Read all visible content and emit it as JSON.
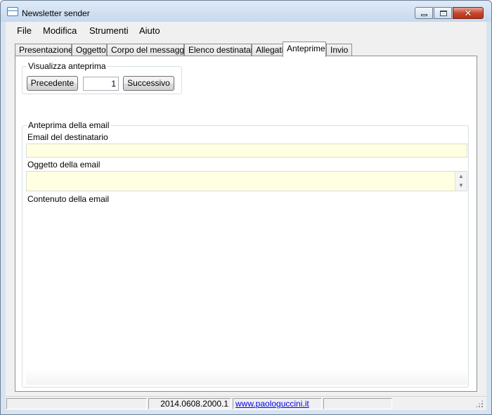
{
  "window": {
    "title": "Newsletter sender",
    "icon": "app-window-icon"
  },
  "menu": {
    "items": [
      {
        "label": "File"
      },
      {
        "label": "Modifica"
      },
      {
        "label": "Strumenti"
      },
      {
        "label": "Aiuto"
      }
    ]
  },
  "tabs": [
    {
      "label": "Presentazione"
    },
    {
      "label": "Oggetto"
    },
    {
      "label": "Corpo del messaggio"
    },
    {
      "label": "Elenco destinatari"
    },
    {
      "label": "Allegati"
    },
    {
      "label": "Anteprime",
      "active": true
    },
    {
      "label": "Invio"
    }
  ],
  "preview_nav": {
    "group_title": "Visualizza anteprima",
    "prev_label": "Precedente",
    "index_value": "1",
    "next_label": "Successivo"
  },
  "email_preview": {
    "group_title": "Anteprima della email",
    "recipient_label": "Email del destinatario",
    "recipient_value": "",
    "subject_label": "Oggetto della email",
    "subject_value": "",
    "content_label": "Contenuto della email",
    "content_value": ""
  },
  "statusbar": {
    "version": "2014.0608.2000.1",
    "link": "www.paologuccini.it"
  },
  "colors": {
    "field_bg": "#ffffe1",
    "close_button": "#c7482f",
    "link": "#0000ee"
  }
}
